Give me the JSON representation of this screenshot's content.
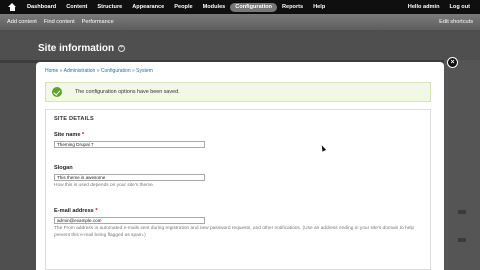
{
  "toolbar": {
    "menu": [
      "Dashboard",
      "Content",
      "Structure",
      "Appearance",
      "People",
      "Modules",
      "Configuration",
      "Reports",
      "Help"
    ],
    "active": "Configuration",
    "user": "Hello admin",
    "logout": "Log out"
  },
  "shortcuts": {
    "items": [
      "Add content",
      "Find content",
      "Performance"
    ],
    "edit": "Edit shortcuts"
  },
  "page": {
    "title": "Site information",
    "plus": "+"
  },
  "overlay": {
    "close": "×",
    "breadcrumb": "Home » Administration » Configuration » System"
  },
  "status": {
    "message": "The configuration options have been saved."
  },
  "site_details": {
    "legend": "SITE DETAILS",
    "site_name_label": "Site name",
    "site_name_value": "Theming Drupal 7",
    "slogan_label": "Slogan",
    "slogan_value": "This theme is awesome",
    "slogan_desc": "How this is used depends on your site's theme.",
    "email_label": "E-mail address",
    "email_value": "admin@example.com",
    "email_desc": "The From address in automated e-mails sent during registration and new password requests, and other notifications. (Use an address ending in your site's domain to help prevent this e-mail being flagged as spam.)",
    "required_marker": "*"
  }
}
